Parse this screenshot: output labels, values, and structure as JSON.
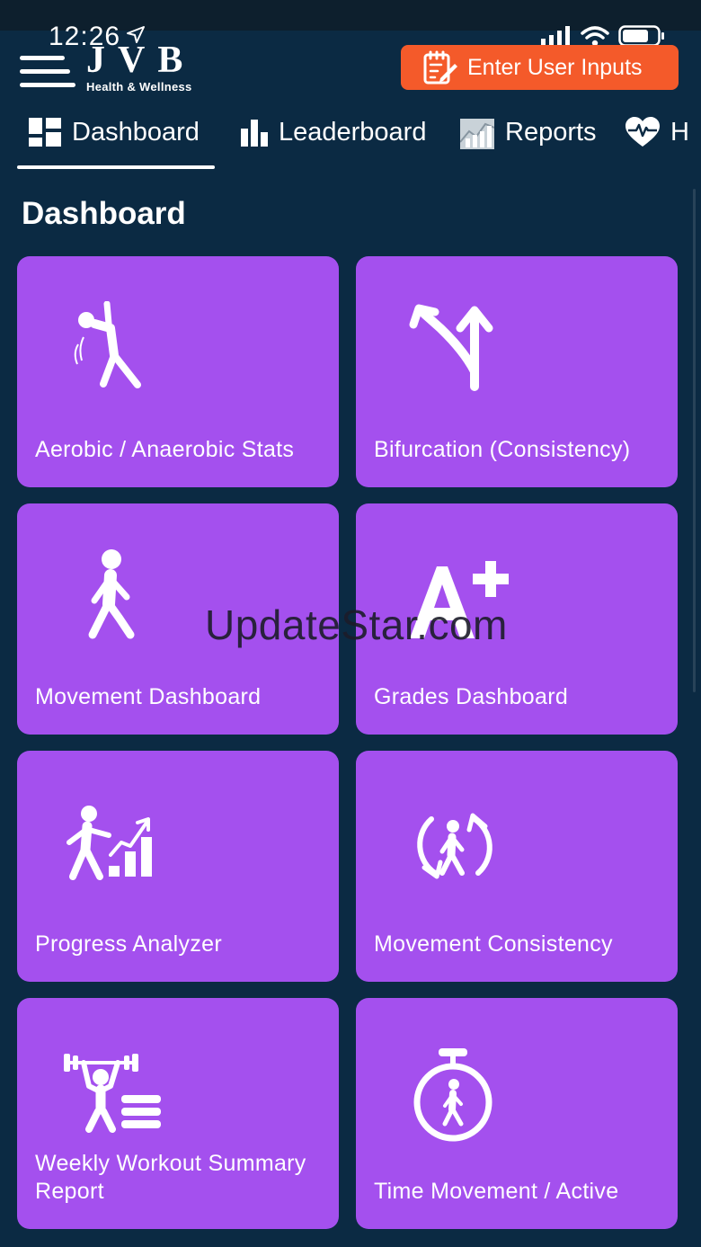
{
  "status": {
    "time": "12:26"
  },
  "header": {
    "logo_mark": "JVB",
    "logo_sub": "Health & Wellness",
    "cta_label": "Enter User Inputs"
  },
  "tabs": [
    {
      "label": "Dashboard",
      "icon": "dashboard-grid-icon",
      "active": true
    },
    {
      "label": "Leaderboard",
      "icon": "bar-chart-icon"
    },
    {
      "label": "Reports",
      "icon": "reports-chart-icon"
    },
    {
      "label": "H",
      "icon": "heart-pulse-icon"
    }
  ],
  "page": {
    "title": "Dashboard"
  },
  "cards": [
    {
      "label": "Aerobic / Anaerobic Stats",
      "icon": "stretching-person-icon"
    },
    {
      "label": "Bifurcation (Consistency)",
      "icon": "split-arrows-icon"
    },
    {
      "label": "Movement Dashboard",
      "icon": "walking-person-icon"
    },
    {
      "label": "Grades Dashboard",
      "icon": "a-plus-grade-icon"
    },
    {
      "label": "Progress Analyzer",
      "icon": "progress-climb-icon"
    },
    {
      "label": "Movement Consistency",
      "icon": "cycle-walker-icon"
    },
    {
      "label": "Weekly Workout Summary Report",
      "icon": "weightlifter-list-icon"
    },
    {
      "label": "Time Movement / Active",
      "icon": "stopwatch-walker-icon"
    }
  ],
  "watermark": "UpdateStar.com",
  "colors": {
    "background": "#0b2a43",
    "card": "#a450ee",
    "cta": "#f45a2a"
  }
}
